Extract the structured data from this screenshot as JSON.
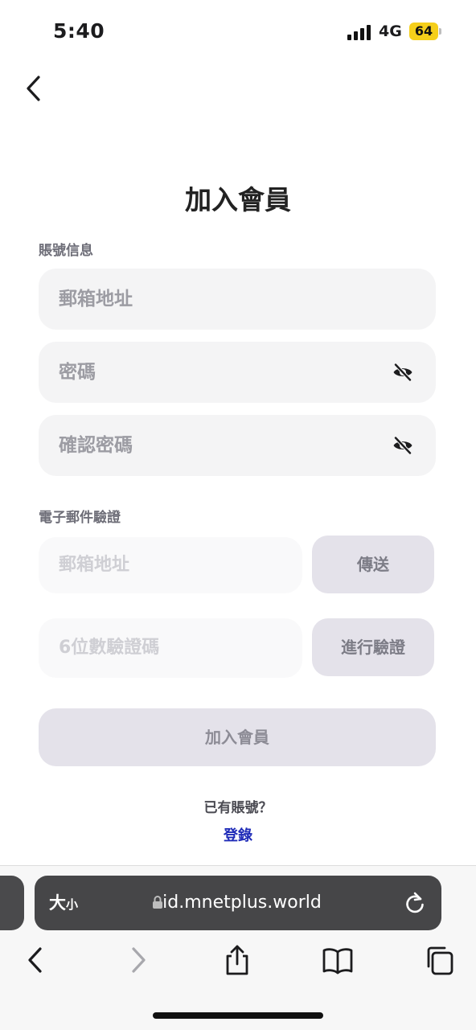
{
  "status_bar": {
    "time": "5:40",
    "network": "4G",
    "battery": "64"
  },
  "page": {
    "title": "加入會員",
    "account_section_label": "賬號信息",
    "email_placeholder": "郵箱地址",
    "password_placeholder": "密碼",
    "confirm_password_placeholder": "確認密碼",
    "verification_section_label": "電子郵件驗證",
    "verify_email_placeholder": "郵箱地址",
    "send_button": "傳送",
    "code_placeholder": "6位數驗證碼",
    "verify_button": "進行驗證",
    "submit_button": "加入會員",
    "have_account_text": "已有賬號？",
    "login_link": "登錄"
  },
  "browser": {
    "text_size_big": "大",
    "text_size_small": "小",
    "url": "id.mnetplus.world",
    "icons": [
      "back-icon",
      "forward-icon",
      "share-icon",
      "bookmarks-icon",
      "tabs-icon",
      "reload-icon",
      "lock-icon"
    ]
  },
  "colors": {
    "login_link": "#1f2bb8",
    "battery": "#f5cf1a",
    "field_bg": "#f4f4f5",
    "button_bg": "#e4e2ea"
  }
}
